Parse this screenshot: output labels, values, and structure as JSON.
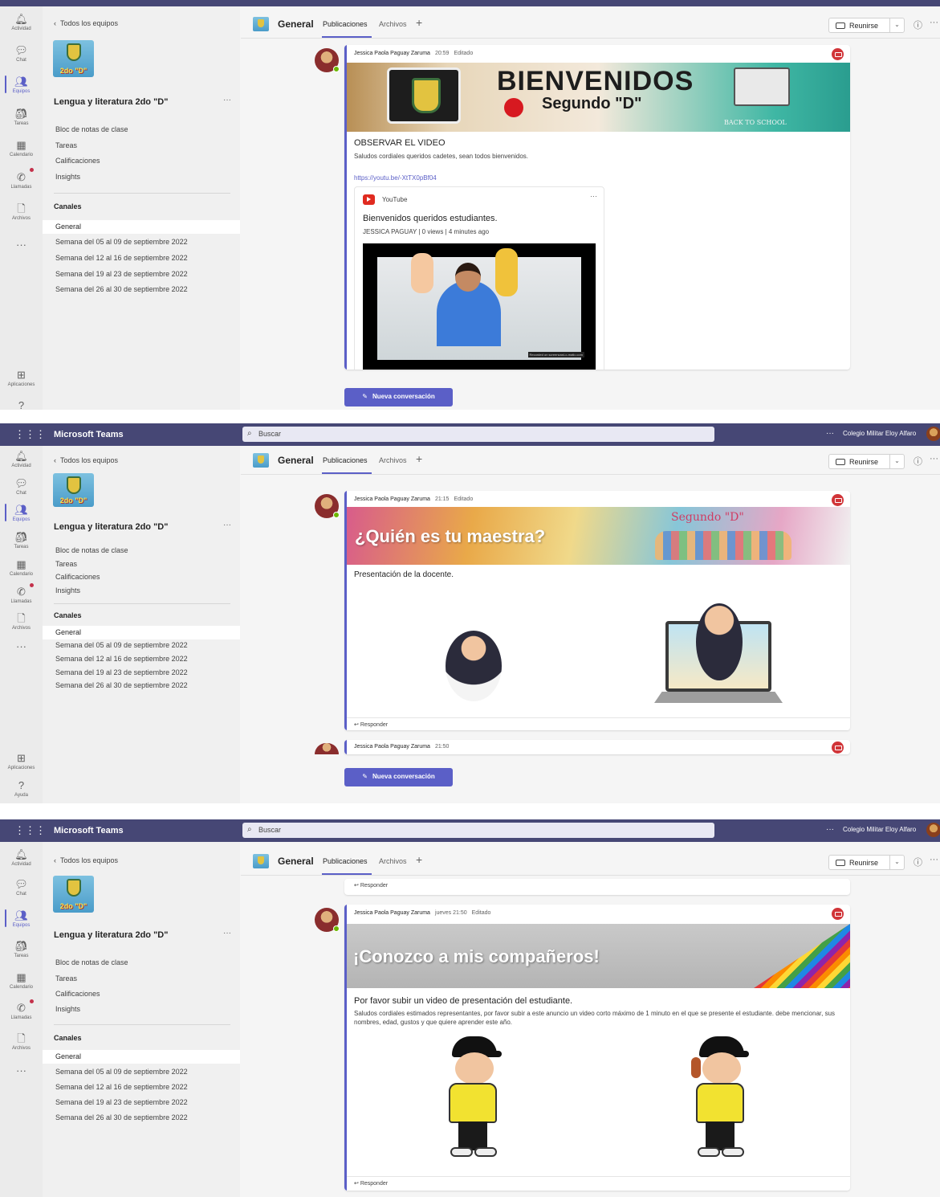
{
  "app": {
    "name": "Microsoft Teams",
    "search_placeholder": "Buscar",
    "org": "Colegio Militar Eloy Alfaro",
    "more": "···"
  },
  "rail": {
    "activity": "Actividad",
    "chat": "Chat",
    "teams": "Equipos",
    "assignments": "Tareas",
    "calendar": "Calendario",
    "calls": "Llamadas",
    "files": "Archivos",
    "more": "···",
    "apps": "Aplicaciones",
    "help": "Ayuda"
  },
  "team": {
    "back": "Todos los equipos",
    "logo_text": "2do \"D\"",
    "name": "Lengua y literatura 2do \"D\"",
    "more": "···",
    "links": [
      "Bloc de notas de clase",
      "Tareas",
      "Calificaciones",
      "Insights"
    ],
    "channels_header": "Canales",
    "channels": [
      "General",
      "Semana del 05 al 09 de septiembre 2022",
      "Semana del 12 al 16 de septiembre 2022",
      "Semana del 19 al 23 de septiembre 2022",
      "Semana del 26 al 30 de septiembre 2022"
    ]
  },
  "channel": {
    "name": "General",
    "tabs": [
      "Publicaciones",
      "Archivos"
    ],
    "add_tab": "+",
    "meet_label": "Reunirse",
    "meet_dropdown": "⌄",
    "info": "ⓘ",
    "more": "···"
  },
  "post1": {
    "author": "Jessica Paola Paguay Zaruma",
    "time": "20:59",
    "edited": "Editado",
    "banner_title": "BIENVENIDOS",
    "banner_subtitle": "Segundo \"D\"",
    "banner_side": "BACK TO SCHOOL",
    "subject": "OBSERVAR EL VIDEO",
    "body": "Saludos cordiales queridos cadetes, sean todos bienvenidos.",
    "url": "https://youtu.be/-XtTX0pBf04",
    "card": {
      "source": "YouTube",
      "more": "···",
      "title": "Bienvenidos queridos estudiantes.",
      "meta": "JESSICA PAGUAY | 0 views | 4 minutes ago",
      "watermark": "Recorded on screencast-o-matic.com"
    }
  },
  "post2": {
    "author": "Jessica Paola Paguay Zaruma",
    "time": "21:15",
    "edited": "Editado",
    "banner_title": "¿Quién es tu maestra?",
    "banner_side": "Segundo \"D\"",
    "subject": "Presentación de la docente.",
    "reply": "Responder"
  },
  "post2b": {
    "author": "Jessica Paola Paguay Zaruma",
    "time": "21:50"
  },
  "post3": {
    "author": "Jessica Paola Paguay Zaruma",
    "time": "jueves 21:50",
    "edited": "Editado",
    "banner_title": "¡Conozco a mis compañeros!",
    "subject": "Por favor subir un video de presentación del estudiante.",
    "body": "Saludos cordiales estimados representantes, por favor subir a este anuncio un video corto máximo de 1 minuto en el que se presente el estudiante. debe mencionar, sus nombres, edad, gustos y que quiere aprender este año.",
    "reply": "Responder"
  },
  "prev_reply": "Responder",
  "compose": {
    "label": "Nueva conversación",
    "icon": "✎"
  },
  "icons": {
    "activity": "bell-icon",
    "chat": "chat-icon",
    "teams": "teams-icon",
    "assignments": "assignments-icon",
    "calendar": "calendar-icon",
    "calls": "phone-icon",
    "files": "file-icon",
    "apps": "apps-icon",
    "help": "help-icon",
    "announcement": "megaphone-icon",
    "reply": "reply-icon",
    "youtube": "youtube-icon"
  },
  "colors": {
    "brand": "#464775",
    "accent": "#5b5fc7",
    "announcement": "#d13438",
    "online": "#6bb700"
  }
}
